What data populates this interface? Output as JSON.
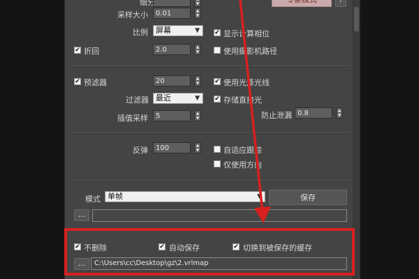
{
  "top_button": "专家模式",
  "row1": {
    "label": "细分",
    "value": ""
  },
  "row2": {
    "label": "采样大小",
    "value": "0.01"
  },
  "row3": {
    "label": "比例",
    "select": "屏幕"
  },
  "cb_show_phase": {
    "label": "显示计算相位",
    "checked": true
  },
  "cb_fold": {
    "label": "折回",
    "checked": true,
    "value": "2.0"
  },
  "cb_camera_path": {
    "label": "使用摄影机路径",
    "checked": false
  },
  "cb_prefilter": {
    "label": "预滤器",
    "checked": true,
    "value": "20"
  },
  "cb_use_light": {
    "label": "使用光泽光线",
    "checked": true
  },
  "filter": {
    "label": "过滤器",
    "select": "最近"
  },
  "cb_store_direct": {
    "label": "存储直接光",
    "checked": true
  },
  "interp": {
    "label": "插值采样",
    "value": "5"
  },
  "leak": {
    "label": "防止泄漏",
    "value": "0.8"
  },
  "bounce": {
    "label": "反弹",
    "value": "100"
  },
  "cb_adaptive": {
    "label": "自适应跟踪",
    "checked": false
  },
  "cb_direction": {
    "label": "仅使用方向",
    "checked": false
  },
  "mode": {
    "label": "模式",
    "select": "单帧",
    "save_button": "保存"
  },
  "browse_label": "...",
  "bottom": {
    "cb_no_delete": {
      "label": "不删除",
      "checked": true
    },
    "cb_auto_save": {
      "label": "自动保存",
      "checked": true
    },
    "cb_switch_cache": {
      "label": "切换到被保存的缓存",
      "checked": true
    },
    "path": "C:\\Users\\cc\\Desktop\\gz\\2.vrlmap"
  },
  "colors": {
    "highlight": "#d82020",
    "panel": "#444444"
  },
  "check_mark": "✔"
}
